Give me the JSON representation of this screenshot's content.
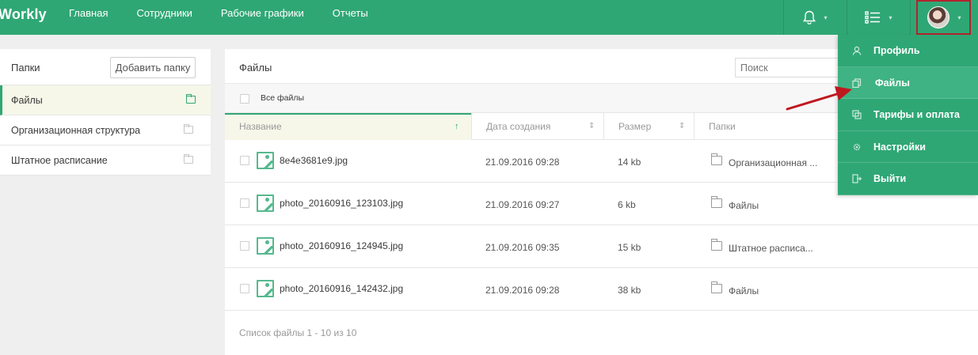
{
  "app": {
    "logo": "Workly"
  },
  "nav": [
    "Главная",
    "Сотрудники",
    "Рабочие графики",
    "Отчеты"
  ],
  "topbar": {
    "caret": "▾"
  },
  "folders": {
    "title": "Папки",
    "add_button": "Добавить папку",
    "items": [
      {
        "label": "Файлы",
        "active": true
      },
      {
        "label": "Организационная структура"
      },
      {
        "label": "Штатное расписание"
      }
    ]
  },
  "files": {
    "title": "Файлы",
    "search_placeholder": "Поиск",
    "all_files_label": "Все файлы",
    "columns": {
      "name": "Название",
      "date": "Дата создания",
      "size": "Размер",
      "folder": "Папки"
    },
    "rows": [
      {
        "name": "8e4e3681e9.jpg",
        "date": "21.09.2016 09:28",
        "size": "14 kb",
        "folder": "Организационная ..."
      },
      {
        "name": "photo_20160916_123103.jpg",
        "date": "21.09.2016 09:27",
        "size": "6 kb",
        "folder": "Файлы"
      },
      {
        "name": "photo_20160916_124945.jpg",
        "date": "21.09.2016 09:35",
        "size": "15 kb",
        "folder": "Штатное расписа..."
      },
      {
        "name": "photo_20160916_142432.jpg",
        "date": "21.09.2016 09:28",
        "size": "38 kb",
        "folder": "Файлы"
      }
    ],
    "footer": "Список файлы 1 - 10 из 10"
  },
  "user_menu": {
    "items": [
      {
        "label": "Профиль",
        "icon": "profile-icon"
      },
      {
        "label": "Файлы",
        "icon": "files-icon",
        "active": true
      },
      {
        "label": "Тарифы и оплата",
        "icon": "tariffs-icon"
      },
      {
        "label": "Настройки",
        "icon": "settings-icon"
      },
      {
        "label": "Выйти",
        "icon": "logout-icon"
      }
    ]
  },
  "colors": {
    "brand": "#2fa775",
    "highlight_box": "#b3232d",
    "annotation_arrow": "#c0181f"
  }
}
